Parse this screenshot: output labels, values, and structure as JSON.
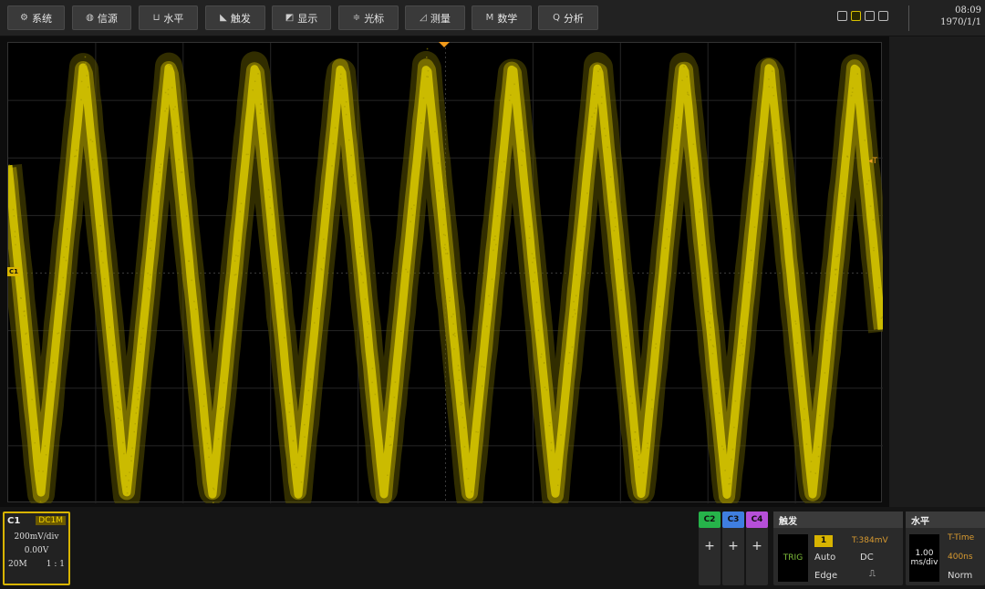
{
  "menu": [
    {
      "icon": "gear-icon",
      "glyph": "⚙",
      "label": "系统"
    },
    {
      "icon": "acquire-icon",
      "glyph": "◍",
      "label": "信源"
    },
    {
      "icon": "horizontal-icon",
      "glyph": "⊔",
      "label": "水平"
    },
    {
      "icon": "trigger-icon",
      "glyph": "◣",
      "label": "触发"
    },
    {
      "icon": "display-icon",
      "glyph": "◩",
      "label": "显示"
    },
    {
      "icon": "cursor-icon",
      "glyph": "≑",
      "label": "光标"
    },
    {
      "icon": "measure-icon",
      "glyph": "◿",
      "label": "测量"
    },
    {
      "icon": "math-icon",
      "glyph": "M",
      "label": "数学"
    },
    {
      "icon": "analysis-icon",
      "glyph": "Q",
      "label": "分析"
    }
  ],
  "clock": {
    "time": "08:09",
    "date": "1970/1/1"
  },
  "markers": {
    "c1": "C1",
    "trigger_level": "◂T"
  },
  "channel1": {
    "name": "C1",
    "coupling": "DC1M",
    "scale": "200mV/div",
    "offset": "0.00V",
    "bandwidth": "20M",
    "probe": "1 : 1"
  },
  "channels": [
    {
      "name": "C2",
      "color": "#26b34a",
      "plus": "+"
    },
    {
      "name": "C3",
      "color": "#3f7ee0",
      "plus": "+"
    },
    {
      "name": "C4",
      "color": "#b64fd9",
      "plus": "+"
    }
  ],
  "trigger": {
    "title": "触发",
    "status": "TRIG",
    "source": "1",
    "level": "T:384mV",
    "mode": "Auto",
    "coupling": "DC",
    "type": "Edge",
    "slope": "⎍"
  },
  "horizontal": {
    "title": "水平",
    "scale_value": "1.00",
    "scale_unit": "ms/div",
    "time_label": "T-Time",
    "delay": "400ns",
    "mode": "Norm"
  },
  "colors": {
    "trace": "#d4c400",
    "channel1": "#d8b400",
    "trigger_marker": "#f29a1a"
  },
  "waveform": {
    "type": "triangle",
    "cycles": 10.2,
    "noise": "high"
  }
}
